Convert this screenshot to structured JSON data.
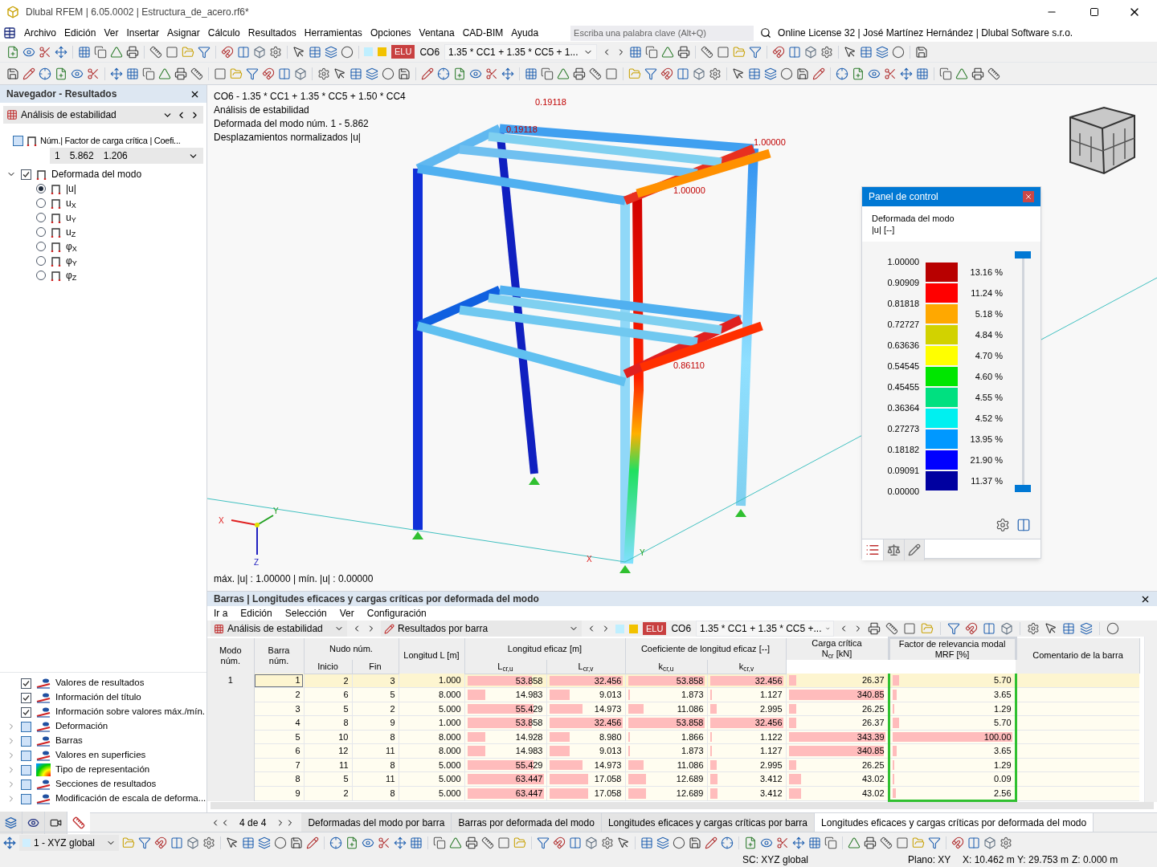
{
  "window": {
    "title": "Dlubal RFEM | 6.05.0002 | Estructura_de_acero.rf6*"
  },
  "menu": [
    "Archivo",
    "Edición",
    "Ver",
    "Insertar",
    "Asignar",
    "Cálculo",
    "Resultados",
    "Herramientas",
    "Opciones",
    "Ventana",
    "CAD-BIM",
    "Ayuda"
  ],
  "search": {
    "placeholder": "Escriba una palabra clave (Alt+Q)"
  },
  "license": "Online License 32 | José Martínez Hernández | Dlubal Software s.r.o.",
  "toolbar": {
    "design_situation": "ELU",
    "combination": "CO6",
    "combination_text": "1.35 * CC1 + 1.35 * CC5 + 1..."
  },
  "navigator": {
    "title": "Navegador - Resultados",
    "analysis": "Análisis de estabilidad",
    "mode_header": {
      "label": "Núm.| Factor de carga crítica | Coefi...",
      "checked": false
    },
    "mode_row": [
      "1",
      "5.862",
      "1.206"
    ],
    "mode_shape": {
      "label": "Deformada del modo",
      "checked": true,
      "expanded": true
    },
    "options": [
      {
        "label": "|u|",
        "selected": true
      },
      {
        "label": "u$_{X}$",
        "selected": false
      },
      {
        "label": "u$_{Y}$",
        "selected": false
      },
      {
        "label": "u$_{Z}$",
        "selected": false
      },
      {
        "label": "φ$_{X}$",
        "selected": false
      },
      {
        "label": "φ$_{Y}$",
        "selected": false
      },
      {
        "label": "φ$_{Z}$",
        "selected": false
      }
    ],
    "display_items": [
      {
        "label": "Valores de resultados",
        "checked": true,
        "kind": "leaf"
      },
      {
        "label": "Información del título",
        "checked": true,
        "kind": "leaf"
      },
      {
        "label": "Información sobre valores máx./mín.",
        "checked": true,
        "kind": "leaf"
      },
      {
        "label": "Deformación",
        "checked": false,
        "kind": "group"
      },
      {
        "label": "Barras",
        "checked": false,
        "kind": "group"
      },
      {
        "label": "Valores en superficies",
        "checked": false,
        "kind": "group"
      },
      {
        "label": "Tipo de representación",
        "checked": false,
        "kind": "group"
      },
      {
        "label": "Secciones de resultados",
        "checked": false,
        "kind": "group"
      },
      {
        "label": "Modificación de escala de deforma...",
        "checked": false,
        "kind": "group"
      }
    ]
  },
  "viewport": {
    "info": [
      "CO6 - 1.35 * CC1 + 1.35 * CC5 + 1.50 * CC4",
      "Análisis de estabilidad",
      "Deformada del modo núm. 1 - 5.862",
      "Desplazamientos normalizados |u|"
    ],
    "value_labels": [
      "0.19118",
      "0.19118",
      "1.00000",
      "1.00000",
      "0.86110"
    ],
    "axes": [
      "X",
      "Y",
      "Z"
    ],
    "origin_axes": [
      "X",
      "Y"
    ],
    "summary": "máx. |u| : 1.00000 | mín. |u| : 0.00000"
  },
  "control_panel": {
    "title": "Panel de control",
    "heading": "Deformada del modo",
    "unit": "|u| [--]",
    "scale_values": [
      "1.00000",
      "0.90909",
      "0.81818",
      "0.72727",
      "0.63636",
      "0.54545",
      "0.45455",
      "0.36364",
      "0.27273",
      "0.18182",
      "0.09091",
      "0.00000"
    ],
    "bands": [
      {
        "color": "#b80000",
        "percent": "13.16 %"
      },
      {
        "color": "#ff0000",
        "percent": "11.24 %"
      },
      {
        "color": "#ffa800",
        "percent": "5.18 %"
      },
      {
        "color": "#d2d200",
        "percent": "4.84 %"
      },
      {
        "color": "#ffff00",
        "percent": "4.70 %"
      },
      {
        "color": "#00e600",
        "percent": "4.60 %"
      },
      {
        "color": "#00e080",
        "percent": "4.55 %"
      },
      {
        "color": "#00f0f0",
        "percent": "4.52 %"
      },
      {
        "color": "#0098ff",
        "percent": "13.95 %"
      },
      {
        "color": "#0000ff",
        "percent": "21.90 %"
      },
      {
        "color": "#0000a0",
        "percent": "11.37 %"
      }
    ]
  },
  "table": {
    "title": "Barras | Longitudes eficaces y cargas críticas por deformada del modo",
    "menu": [
      "Ir a",
      "Edición",
      "Selección",
      "Ver",
      "Configuración"
    ],
    "analysis": "Análisis de estabilidad",
    "result_type": "Resultados por barra",
    "design_situation": "ELU",
    "combination": "CO6",
    "combination_text": "1.35 * CC1 + 1.35 * CC5 +...",
    "columns": [
      {
        "label": "Modo núm."
      },
      {
        "label": "Barra núm."
      },
      {
        "label": "Nudo núm.",
        "sub": [
          "Inicio",
          "Fin"
        ]
      },
      {
        "label": "Longitud L [m]"
      },
      {
        "label": "Longitud eficaz [m]",
        "sub": [
          "L$_{cr,u}$",
          "L$_{cr,v}$"
        ]
      },
      {
        "label": "Coeficiente de longitud eficaz [--]",
        "sub": [
          "k$_{cr,u}$",
          "k$_{cr,v}$"
        ]
      },
      {
        "label": "Carga crítica",
        "sub": [
          "N$_{cr}$ [kN]"
        ]
      },
      {
        "label": "Factor de relevancia modal",
        "sub": [
          "MRF [%]"
        ],
        "highlighted": true
      },
      {
        "label": "Comentario de la barra"
      }
    ],
    "rows": [
      {
        "mode": "1",
        "bar": "1",
        "start": "2",
        "end": "3",
        "length": "1.000",
        "selected": true,
        "values": [
          {
            "text": "53.858",
            "level": 0.85
          },
          {
            "text": "32.456",
            "level": 1
          },
          {
            "text": "53.858",
            "level": 1
          },
          {
            "text": "32.456",
            "level": 1
          },
          {
            "text": "26.37",
            "level": 0.08
          },
          {
            "text": "5.70",
            "level": 0.06
          }
        ]
      },
      {
        "bar": "2",
        "start": "6",
        "end": "5",
        "length": "8.000",
        "selected": false,
        "values": [
          {
            "text": "14.983",
            "level": 0.24
          },
          {
            "text": "9.013",
            "level": 0.28
          },
          {
            "text": "1.873",
            "level": 0.03
          },
          {
            "text": "1.127",
            "level": 0.03
          },
          {
            "text": "340.85",
            "level": 0.99
          },
          {
            "text": "3.65",
            "level": 0.04
          }
        ]
      },
      {
        "bar": "3",
        "start": "5",
        "end": "2",
        "length": "5.000",
        "selected": false,
        "values": [
          {
            "text": "55.429",
            "level": 0.87
          },
          {
            "text": "14.973",
            "level": 0.46
          },
          {
            "text": "11.086",
            "level": 0.21
          },
          {
            "text": "2.995",
            "level": 0.09
          },
          {
            "text": "26.25",
            "level": 0.08
          },
          {
            "text": "1.29",
            "level": 0.01
          }
        ]
      },
      {
        "bar": "4",
        "start": "8",
        "end": "9",
        "length": "1.000",
        "selected": false,
        "values": [
          {
            "text": "53.858",
            "level": 0.85
          },
          {
            "text": "32.456",
            "level": 1
          },
          {
            "text": "53.858",
            "level": 1
          },
          {
            "text": "32.456",
            "level": 1
          },
          {
            "text": "26.37",
            "level": 0.08
          },
          {
            "text": "5.70",
            "level": 0.06
          }
        ]
      },
      {
        "bar": "5",
        "start": "10",
        "end": "8",
        "length": "8.000",
        "selected": false,
        "values": [
          {
            "text": "14.928",
            "level": 0.24
          },
          {
            "text": "8.980",
            "level": 0.28
          },
          {
            "text": "1.866",
            "level": 0.03
          },
          {
            "text": "1.122",
            "level": 0.03
          },
          {
            "text": "343.39",
            "level": 1
          },
          {
            "text": "100.00",
            "level": 1
          }
        ]
      },
      {
        "bar": "6",
        "start": "12",
        "end": "11",
        "length": "8.000",
        "selected": false,
        "values": [
          {
            "text": "14.983",
            "level": 0.24
          },
          {
            "text": "9.013",
            "level": 0.28
          },
          {
            "text": "1.873",
            "level": 0.03
          },
          {
            "text": "1.127",
            "level": 0.03
          },
          {
            "text": "340.85",
            "level": 0.99
          },
          {
            "text": "3.65",
            "level": 0.04
          }
        ]
      },
      {
        "bar": "7",
        "start": "11",
        "end": "8",
        "length": "5.000",
        "selected": false,
        "values": [
          {
            "text": "55.429",
            "level": 0.87
          },
          {
            "text": "14.973",
            "level": 0.46
          },
          {
            "text": "11.086",
            "level": 0.21
          },
          {
            "text": "2.995",
            "level": 0.09
          },
          {
            "text": "26.25",
            "level": 0.08
          },
          {
            "text": "1.29",
            "level": 0.01
          }
        ]
      },
      {
        "bar": "8",
        "start": "5",
        "end": "11",
        "length": "5.000",
        "selected": false,
        "values": [
          {
            "text": "63.447",
            "level": 1
          },
          {
            "text": "17.058",
            "level": 0.53
          },
          {
            "text": "12.689",
            "level": 0.24
          },
          {
            "text": "3.412",
            "level": 0.1
          },
          {
            "text": "43.02",
            "level": 0.13
          },
          {
            "text": "0.09",
            "level": 0.01
          }
        ]
      },
      {
        "bar": "9",
        "start": "2",
        "end": "8",
        "length": "5.000",
        "selected": false,
        "values": [
          {
            "text": "63.447",
            "level": 1
          },
          {
            "text": "17.058",
            "level": 0.53
          },
          {
            "text": "12.689",
            "level": 0.24
          },
          {
            "text": "3.412",
            "level": 0.1
          },
          {
            "text": "43.02",
            "level": 0.13
          },
          {
            "text": "2.56",
            "level": 0.03
          }
        ]
      }
    ]
  },
  "page_nav": "4 de 4",
  "bottom_tabs": [
    {
      "label": "Deformadas del modo por barra",
      "selected": false
    },
    {
      "label": "Barras por deformada del modo",
      "selected": false
    },
    {
      "label": "Longitudes eficaces y cargas críticas por barra",
      "selected": false
    },
    {
      "label": "Longitudes eficaces y cargas críticas por deformada del modo",
      "selected": true
    }
  ],
  "coordinate_system": "1 - XYZ global",
  "status_bar": [
    "SC: XYZ global",
    "Plano: XY",
    "X: 10.462 m",
    "Y: 29.753 m",
    "Z: 0.000 m"
  ]
}
